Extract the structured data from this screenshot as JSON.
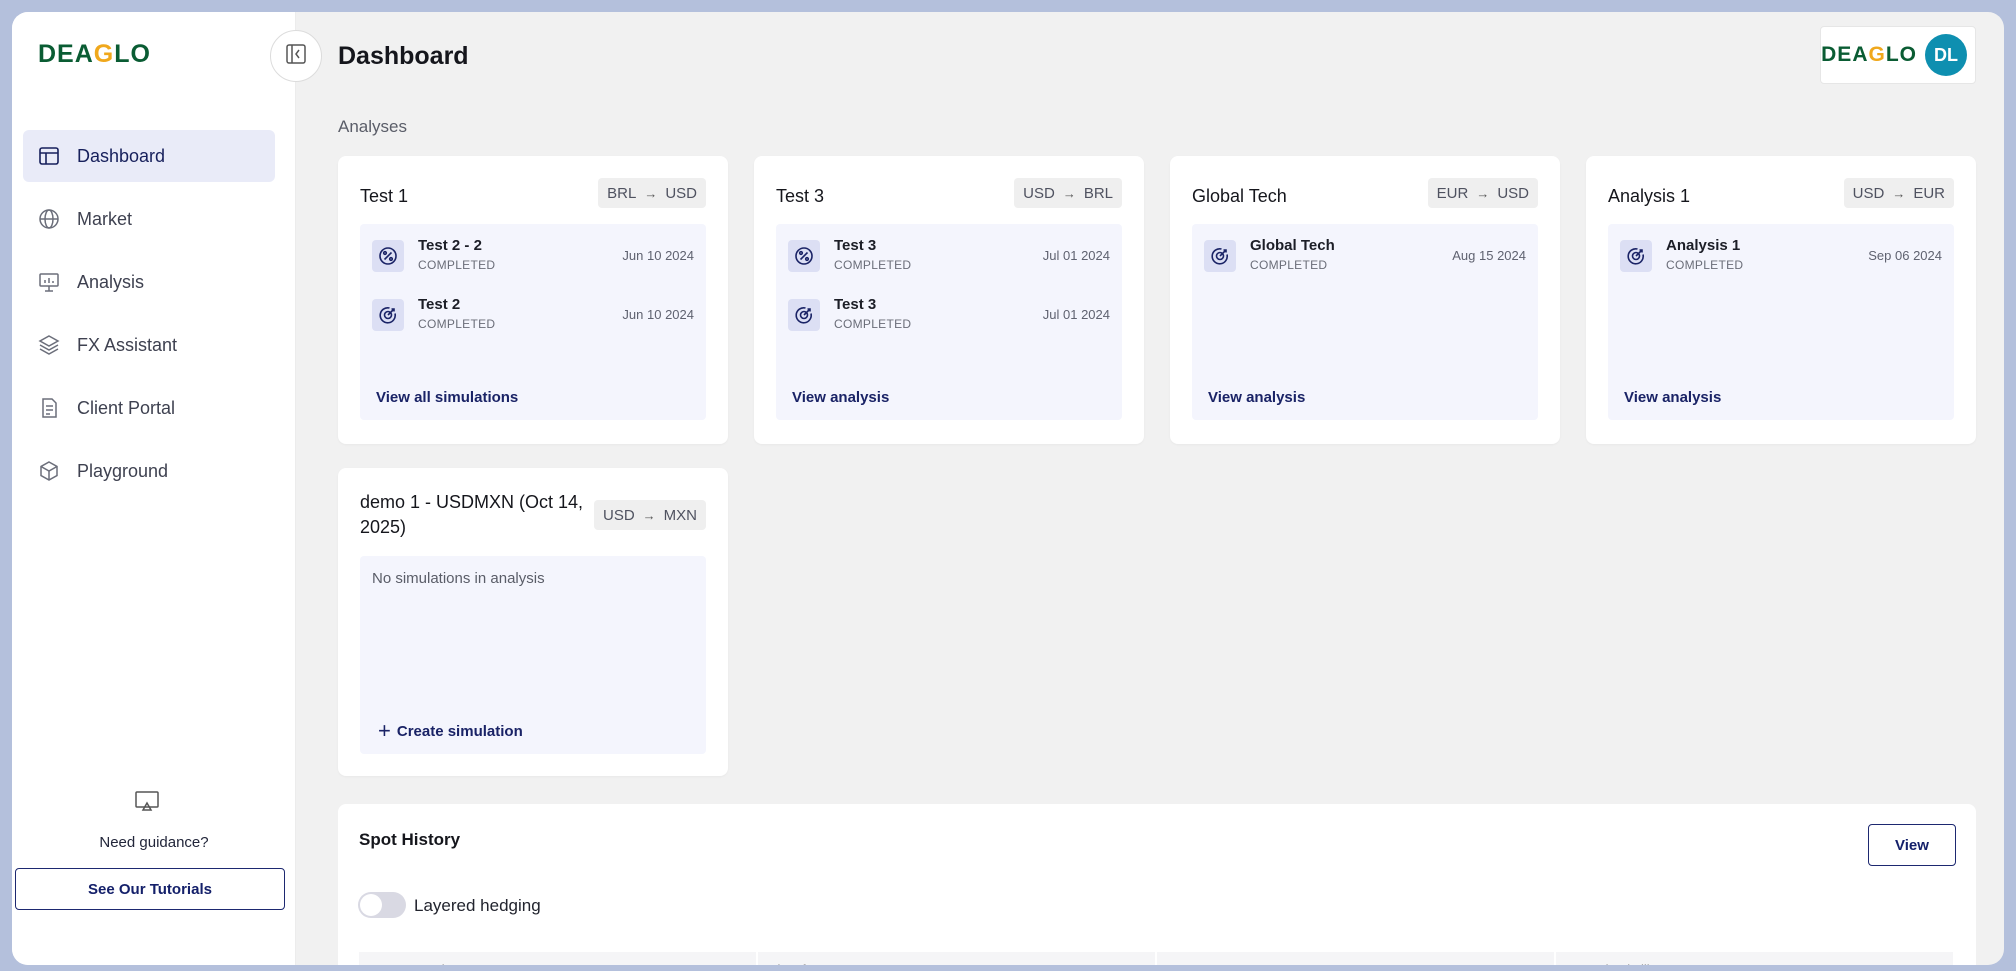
{
  "brand": {
    "logo_pre": "DEA",
    "logo_g": "G",
    "logo_post": "LO"
  },
  "header": {
    "title": "Dashboard",
    "avatar_initials": "DL"
  },
  "sidebar": {
    "items": [
      {
        "label": "Dashboard",
        "icon": "layout-icon",
        "active": true
      },
      {
        "label": "Market",
        "icon": "globe-icon"
      },
      {
        "label": "Analysis",
        "icon": "presentation-chart-icon"
      },
      {
        "label": "FX Assistant",
        "icon": "layers-icon"
      },
      {
        "label": "Client Portal",
        "icon": "document-icon"
      },
      {
        "label": "Playground",
        "icon": "cube-icon"
      }
    ],
    "guidance_text": "Need guidance?",
    "tutorials_button": "See Our Tutorials"
  },
  "analyses": {
    "section_label": "Analyses",
    "cards": [
      {
        "title": "Test 1",
        "from": "BRL",
        "to": "USD",
        "link": "View all simulations",
        "sims": [
          {
            "name": "Test 2 - 2",
            "status": "COMPLETED",
            "date": "Jun 10 2024",
            "icon": "percent-icon"
          },
          {
            "name": "Test 2",
            "status": "COMPLETED",
            "date": "Jun 10 2024",
            "icon": "target-icon"
          }
        ]
      },
      {
        "title": "Test 3",
        "from": "USD",
        "to": "BRL",
        "link": "View analysis",
        "sims": [
          {
            "name": "Test 3",
            "status": "COMPLETED",
            "date": "Jul 01 2024",
            "icon": "percent-icon"
          },
          {
            "name": "Test 3",
            "status": "COMPLETED",
            "date": "Jul 01 2024",
            "icon": "target-icon"
          }
        ]
      },
      {
        "title": "Global Tech",
        "from": "EUR",
        "to": "USD",
        "link": "View analysis",
        "sims": [
          {
            "name": "Global Tech",
            "status": "COMPLETED",
            "date": "Aug 15 2024",
            "icon": "target-icon"
          }
        ]
      },
      {
        "title": "Analysis 1",
        "from": "USD",
        "to": "EUR",
        "link": "View analysis",
        "sims": [
          {
            "name": "Analysis 1",
            "status": "COMPLETED",
            "date": "Sep 06 2024",
            "icon": "target-icon"
          }
        ]
      },
      {
        "title": "demo 1 - USDMXN (Oct 14, 2025)",
        "from": "USD",
        "to": "MXN",
        "empty_text": "No simulations in analysis",
        "create_link": "Create simulation"
      }
    ]
  },
  "spot_history": {
    "title": "Spot History",
    "view_button": "View",
    "toggle_label": "Layered hedging",
    "toggle_on": false,
    "columns": [
      "Currency pair",
      "Time frame",
      "Spot rate",
      "Annual Volatility"
    ]
  },
  "colors": {
    "brand_green": "#0a5c33",
    "brand_orange": "#f0a81c",
    "navy": "#1a2366",
    "avatar": "#0e8fb0"
  }
}
